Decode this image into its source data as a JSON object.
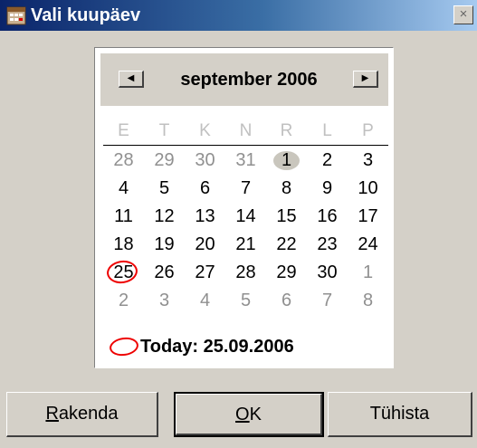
{
  "window": {
    "title": "Vali kuupäev",
    "app_icon": "calendar-app-icon",
    "close_label": "×"
  },
  "calendar": {
    "month_label": "september 2006",
    "prev_label": "◀",
    "next_label": "▶",
    "weekdays": [
      "E",
      "T",
      "K",
      "N",
      "R",
      "L",
      "P"
    ],
    "weeks": [
      [
        "28",
        "29",
        "30",
        "31",
        "1",
        "2",
        "3"
      ],
      [
        "4",
        "5",
        "6",
        "7",
        "8",
        "9",
        "10"
      ],
      [
        "11",
        "12",
        "13",
        "14",
        "15",
        "16",
        "17"
      ],
      [
        "18",
        "19",
        "20",
        "21",
        "22",
        "23",
        "24"
      ],
      [
        "25",
        "26",
        "27",
        "28",
        "29",
        "30",
        "1"
      ],
      [
        "2",
        "3",
        "4",
        "5",
        "6",
        "7",
        "8"
      ]
    ],
    "other_month_cells": [
      [
        0,
        0
      ],
      [
        0,
        1
      ],
      [
        0,
        2
      ],
      [
        0,
        3
      ],
      [
        4,
        6
      ],
      [
        5,
        0
      ],
      [
        5,
        1
      ],
      [
        5,
        2
      ],
      [
        5,
        3
      ],
      [
        5,
        4
      ],
      [
        5,
        5
      ],
      [
        5,
        6
      ]
    ],
    "selected_cell": [
      0,
      4
    ],
    "today_cell": [
      4,
      0
    ],
    "today_text": "Today: 25.09.2006"
  },
  "buttons": {
    "apply_mnemonic": "R",
    "apply_rest": "akenda",
    "ok_mnemonic": "O",
    "ok_rest": "K",
    "cancel": "Tühista"
  },
  "colors": {
    "selected_bg": "#c9c6bd",
    "today_ring": "#e00000",
    "title_gradient_start": "#0a246a"
  }
}
